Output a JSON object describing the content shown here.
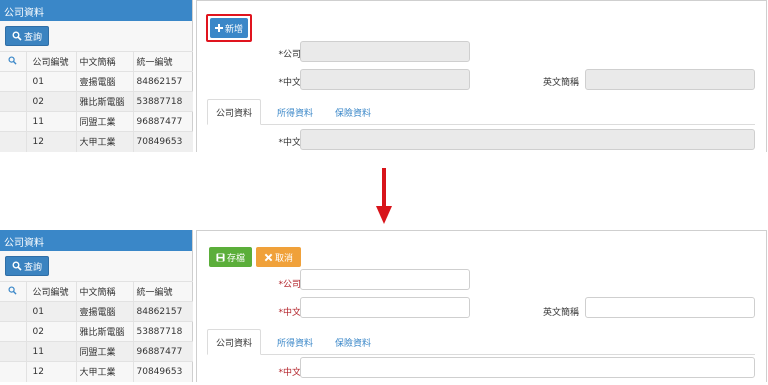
{
  "list_panel": {
    "title": "公司資料",
    "query_label": "查詢",
    "columns": [
      "公司編號",
      "中文簡稱",
      "統一編號"
    ],
    "rows": [
      [
        "01",
        "壹揚電腦",
        "84862157"
      ],
      [
        "02",
        "雅比斯電腦",
        "53887718"
      ],
      [
        "11",
        "同盟工業",
        "96887477"
      ],
      [
        "12",
        "大甲工業",
        "70849653"
      ]
    ]
  },
  "form": {
    "add_label": "新增",
    "save_label": "存檔",
    "cancel_label": "取消",
    "company_id_label": "*公司編號",
    "cn_short_label": "*中文簡稱",
    "en_short_label": "英文簡稱",
    "cn_full_label": "*中文全名",
    "company_id_value": "",
    "cn_short_value": "",
    "en_short_value": "",
    "cn_full_value": ""
  },
  "tabs": [
    "公司資料",
    "所得資料",
    "保險資料"
  ],
  "colors": {
    "header_blue": "#3a87c8",
    "save_green": "#5bae3a",
    "cancel_orange": "#f0a13a",
    "highlight_red": "#e0141e",
    "required_red": "#b3242b"
  }
}
